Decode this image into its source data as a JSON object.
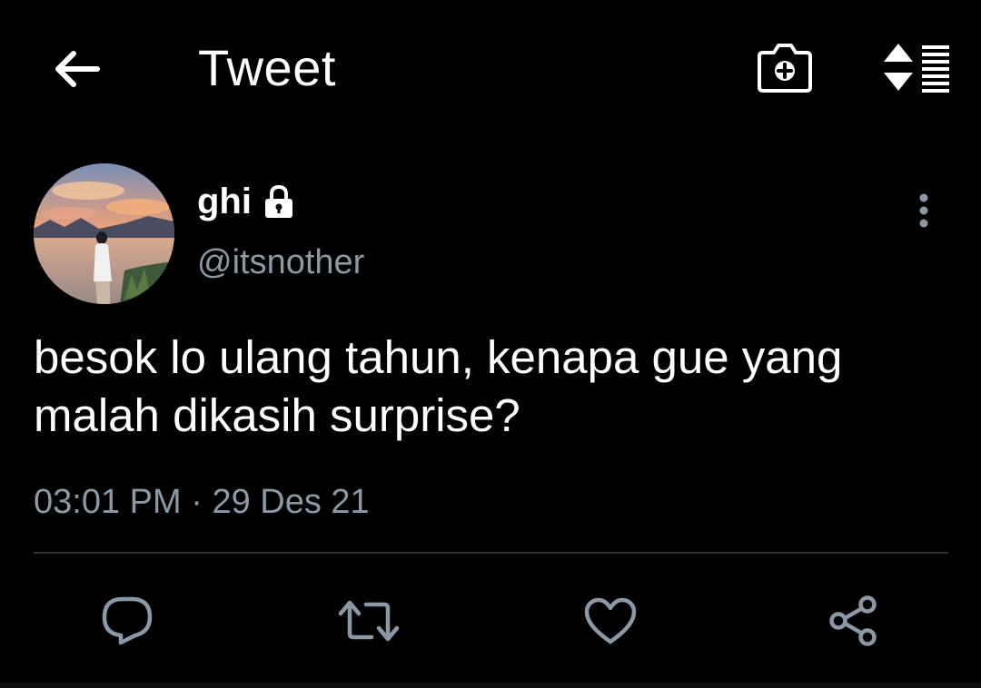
{
  "header": {
    "title": "Tweet",
    "back_icon": "arrow-left-icon",
    "camera_icon": "camera-plus-icon",
    "sort_icon": "sort-list-icon"
  },
  "tweet": {
    "display_name": "ghi",
    "protected_icon": "lock-icon",
    "handle": "@itsnother",
    "text": "besok lo ulang tahun, kenapa gue yang malah dikasih surprise?",
    "time": "03:01 PM",
    "separator": "·",
    "date": "29 Des 21",
    "more_icon": "more-vertical-icon"
  },
  "actions": {
    "reply_icon": "reply-icon",
    "retweet_icon": "retweet-icon",
    "like_icon": "heart-icon",
    "share_icon": "share-icon"
  },
  "colors": {
    "background": "#000000",
    "text_primary": "#ffffff",
    "text_secondary": "#8b98a5",
    "divider": "#2f3336"
  }
}
